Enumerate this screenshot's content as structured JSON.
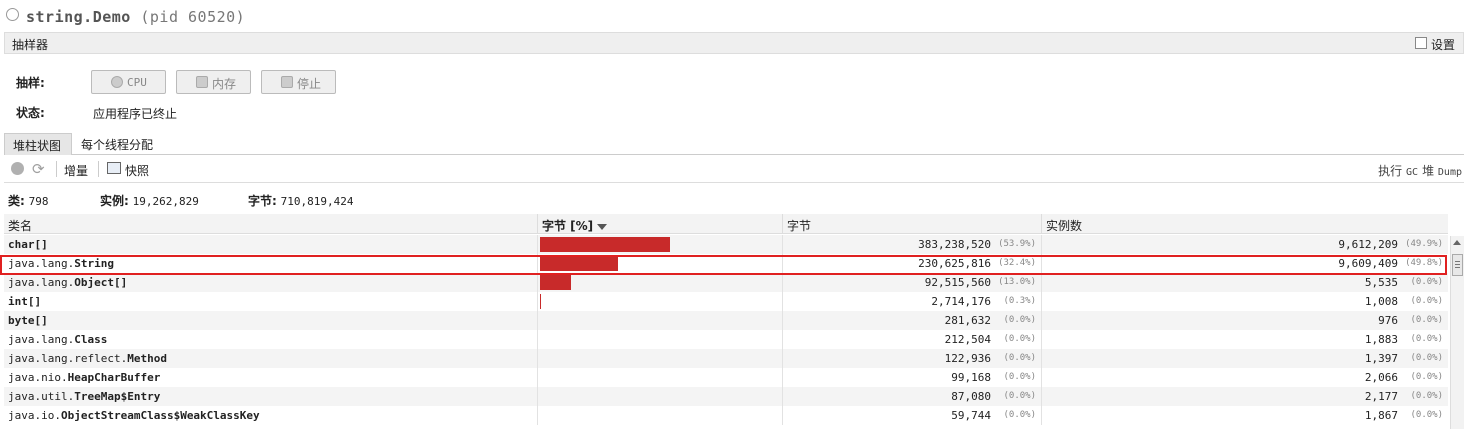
{
  "window": {
    "app_name": "string.Demo",
    "pid": "(pid 60520)"
  },
  "sampler": {
    "header": "抽样器",
    "settings_label": "设置"
  },
  "controls": {
    "sample_label": "抽样:",
    "cpu_button": "CPU",
    "memory_button": "内存",
    "stop_button": "停止",
    "status_label": "状态:",
    "status_value": "应用程序已终止"
  },
  "tabs": [
    {
      "label": "堆柱状图",
      "selected": true
    },
    {
      "label": "每个线程分配",
      "selected": false
    }
  ],
  "toolbar": {
    "delta_label": "增量",
    "snapshot_label": "快照",
    "gc_label": "执行 GC",
    "gc_suffix": "GC",
    "gc_prefix": "执行",
    "dump_prefix": "堆",
    "dump_suffix": "Dump"
  },
  "summary": {
    "classes_label": "类:",
    "classes_value": "798",
    "instances_label": "实例:",
    "instances_value": "19,262,829",
    "bytes_label": "字节:",
    "bytes_value": "710,819,424"
  },
  "table": {
    "columns": {
      "name": "类名",
      "bytes_pct": "字节 [%]",
      "bytes": "字节",
      "instances": "实例数"
    },
    "rows": [
      {
        "pkg": "",
        "cls": "char[]",
        "bytes": "383,238,520",
        "bytes_pct": "(53.9%)",
        "instances": "9,612,209",
        "inst_pct": "(49.9%)",
        "fraction": 0.539
      },
      {
        "pkg": "java.lang.",
        "cls": "String",
        "bytes": "230,625,816",
        "bytes_pct": "(32.4%)",
        "instances": "9,609,409",
        "inst_pct": "(49.8%)",
        "fraction": 0.324
      },
      {
        "pkg": "java.lang.",
        "cls": "Object[]",
        "bytes": "92,515,560",
        "bytes_pct": "(13.0%)",
        "instances": "5,535",
        "inst_pct": "(0.0%)",
        "fraction": 0.13
      },
      {
        "pkg": "",
        "cls": "int[]",
        "bytes": "2,714,176",
        "bytes_pct": "(0.3%)",
        "instances": "1,008",
        "inst_pct": "(0.0%)",
        "fraction": 0.003
      },
      {
        "pkg": "",
        "cls": "byte[]",
        "bytes": "281,632",
        "bytes_pct": "(0.0%)",
        "instances": "976",
        "inst_pct": "(0.0%)",
        "fraction": 0.0
      },
      {
        "pkg": "java.lang.",
        "cls": "Class",
        "bytes": "212,504",
        "bytes_pct": "(0.0%)",
        "instances": "1,883",
        "inst_pct": "(0.0%)",
        "fraction": 0.0
      },
      {
        "pkg": "java.lang.reflect.",
        "cls": "Method",
        "bytes": "122,936",
        "bytes_pct": "(0.0%)",
        "instances": "1,397",
        "inst_pct": "(0.0%)",
        "fraction": 0.0
      },
      {
        "pkg": "java.nio.",
        "cls": "HeapCharBuffer",
        "bytes": "99,168",
        "bytes_pct": "(0.0%)",
        "instances": "2,066",
        "inst_pct": "(0.0%)",
        "fraction": 0.0
      },
      {
        "pkg": "java.util.",
        "cls": "TreeMap$Entry",
        "bytes": "87,080",
        "bytes_pct": "(0.0%)",
        "instances": "2,177",
        "inst_pct": "(0.0%)",
        "fraction": 0.0
      },
      {
        "pkg": "java.io.",
        "cls": "ObjectStreamClass$WeakClassKey",
        "bytes": "59,744",
        "bytes_pct": "(0.0%)",
        "instances": "1,867",
        "inst_pct": "(0.0%)",
        "fraction": 0.0
      }
    ]
  },
  "colors": {
    "bar": "#c82a2a",
    "highlight": "#e02020"
  }
}
